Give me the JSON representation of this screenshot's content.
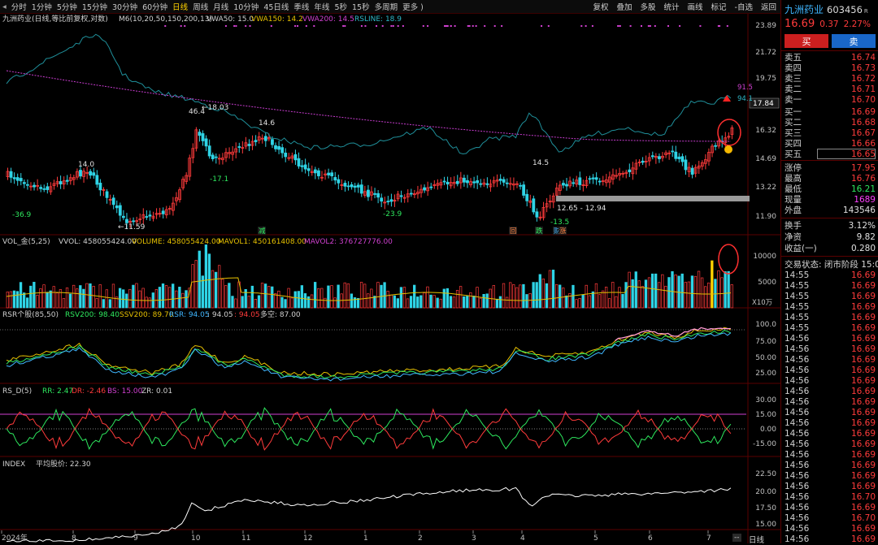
{
  "toolbar": {
    "timeframes": [
      {
        "label": "分时",
        "active": false
      },
      {
        "label": "1分钟",
        "active": false
      },
      {
        "label": "5分钟",
        "active": false
      },
      {
        "label": "15分钟",
        "active": false
      },
      {
        "label": "30分钟",
        "active": false
      },
      {
        "label": "60分钟",
        "active": false
      },
      {
        "label": "日线",
        "active": true
      },
      {
        "label": "周线",
        "active": false
      },
      {
        "label": "月线",
        "active": false
      },
      {
        "label": "10分钟",
        "active": false
      },
      {
        "label": "45日线",
        "active": false
      },
      {
        "label": "季线",
        "active": false
      },
      {
        "label": "年线",
        "active": false
      },
      {
        "label": "5秒",
        "active": false
      },
      {
        "label": "15秒",
        "active": false
      },
      {
        "label": "多周期",
        "active": false
      },
      {
        "label": "更多 )",
        "active": false
      }
    ],
    "right": [
      "复权",
      "叠加",
      "多股",
      "统计",
      "画线",
      "标记",
      "-自选",
      "返回"
    ]
  },
  "main": {
    "title": "九洲药业(日线,等比前复权,对数)",
    "ma_label": "M6(10,20,50,150,200,13)",
    "vwa50": "VWA50: 15.0",
    "vwa150": "VWA150: 14.2",
    "vwa200": "VWA200: 14.5",
    "rsline": "RSLINE: 18.9",
    "y_labels": [
      "23.89",
      "21.72",
      "19.75",
      "17.84",
      "16.32",
      "14.69",
      "13.22",
      "11.90"
    ],
    "current_price": "17.84",
    "ann": {
      "hi": "18.03",
      "p464": "46.4",
      "p146": "14.6",
      "p140": "14.0",
      "p145": "14.5",
      "lo": "11.59",
      "n369": "-36.9",
      "n171": "-17.1",
      "n239": "-23.9",
      "n135": "-13.5",
      "range": "12.65 - 12.94",
      "r915": "91.5",
      "r941": "94.1"
    },
    "markers": [
      "减",
      "回",
      "跌",
      "财",
      "涨"
    ]
  },
  "vol": {
    "name": "VOL_金(5,25)",
    "vvol": "VVOL: 458055424.00",
    "volume": "VOLUME: 458055424.00",
    "mavol1": "MAVOL1: 450161408.00",
    "mavol2": "MAVOL2: 376727776.00",
    "y_labels": [
      "10000",
      "5000"
    ],
    "unit": "X10万"
  },
  "rsr": {
    "name": "RSR个股(85,50)",
    "rsv": "RSV200: 98.40",
    "ssv": "SSV200: 89.70",
    "rsr": "RSR: 94.05",
    "v1": ": 94.05",
    "v2": ": 94.05",
    "duokong": "多空: 87.00",
    "y_labels": [
      "100.0",
      "75.00",
      "50.00",
      "25.00"
    ]
  },
  "rsd": {
    "name": "RS_D(5)",
    "rr": "RR: 2.47",
    "dr": "DR: -2.46",
    "bs": "BS: 15.00",
    "zr": "ZR: 0.01",
    "y_labels": [
      "30.00",
      "15.00",
      "0.00",
      "-15.00"
    ]
  },
  "index": {
    "name": "INDEX",
    "avg": "平均股价: 22.30",
    "y_labels": [
      "22.50",
      "20.00",
      "17.50",
      "15.00"
    ]
  },
  "xaxis": [
    "2024年",
    "8",
    "9",
    "10",
    "11",
    "12",
    "1",
    "2",
    "3",
    "4",
    "5",
    "6",
    "7"
  ],
  "bottom": {
    "dash": "--",
    "line": "日线"
  },
  "quote": {
    "name": "九洲药业",
    "code": "603456",
    "r": "R",
    "price": "16.69",
    "change": "0.37",
    "pct": "2.27%",
    "buy": "买",
    "sell": "卖",
    "asks": [
      {
        "l": "卖五",
        "v": "16.74"
      },
      {
        "l": "卖四",
        "v": "16.73"
      },
      {
        "l": "卖三",
        "v": "16.72"
      },
      {
        "l": "卖二",
        "v": "16.71"
      },
      {
        "l": "卖一",
        "v": "16.70"
      }
    ],
    "bids": [
      {
        "l": "买一",
        "v": "16.69"
      },
      {
        "l": "买二",
        "v": "16.68"
      },
      {
        "l": "买三",
        "v": "16.67"
      },
      {
        "l": "买四",
        "v": "16.66"
      },
      {
        "l": "买五",
        "v": "16.65"
      }
    ],
    "stats": [
      {
        "l": "涨停",
        "v": "17.95"
      },
      {
        "l": "最高",
        "v": "16.76"
      },
      {
        "l": "最低",
        "v": "16.21"
      },
      {
        "l": "现量",
        "v": "1689"
      },
      {
        "l": "外盘",
        "v": "143546"
      }
    ],
    "stats2": [
      {
        "l": "换手",
        "v": "3.12%"
      },
      {
        "l": "净资",
        "v": "9.82"
      },
      {
        "l": "收益(一)",
        "v": "0.280"
      }
    ],
    "state": "交易状态: 闭市阶段 15:00",
    "ticks": [
      {
        "t": "14:55",
        "v": "16.69"
      },
      {
        "t": "14:55",
        "v": "16.69"
      },
      {
        "t": "14:55",
        "v": "16.69"
      },
      {
        "t": "14:55",
        "v": "16.69"
      },
      {
        "t": "14:55",
        "v": "16.69"
      },
      {
        "t": "14:55",
        "v": "16.69"
      },
      {
        "t": "14:56",
        "v": "16.69"
      },
      {
        "t": "14:56",
        "v": "16.69"
      },
      {
        "t": "14:56",
        "v": "16.69"
      },
      {
        "t": "14:56",
        "v": "16.69"
      },
      {
        "t": "14:56",
        "v": "16.69"
      },
      {
        "t": "14:56",
        "v": "16.69"
      },
      {
        "t": "14:56",
        "v": "16.69"
      },
      {
        "t": "14:56",
        "v": "16.69"
      },
      {
        "t": "14:56",
        "v": "16.69"
      },
      {
        "t": "14:56",
        "v": "16.69"
      },
      {
        "t": "14:56",
        "v": "16.69"
      },
      {
        "t": "14:56",
        "v": "16.69"
      },
      {
        "t": "14:56",
        "v": "16.69"
      },
      {
        "t": "14:56",
        "v": "16.69"
      },
      {
        "t": "14:56",
        "v": "16.69"
      },
      {
        "t": "14:56",
        "v": "16.70"
      },
      {
        "t": "14:56",
        "v": "16.69"
      },
      {
        "t": "14:56",
        "v": "16.70"
      },
      {
        "t": "14:56",
        "v": "16.69"
      },
      {
        "t": "14:56",
        "v": "16.69"
      }
    ]
  }
}
